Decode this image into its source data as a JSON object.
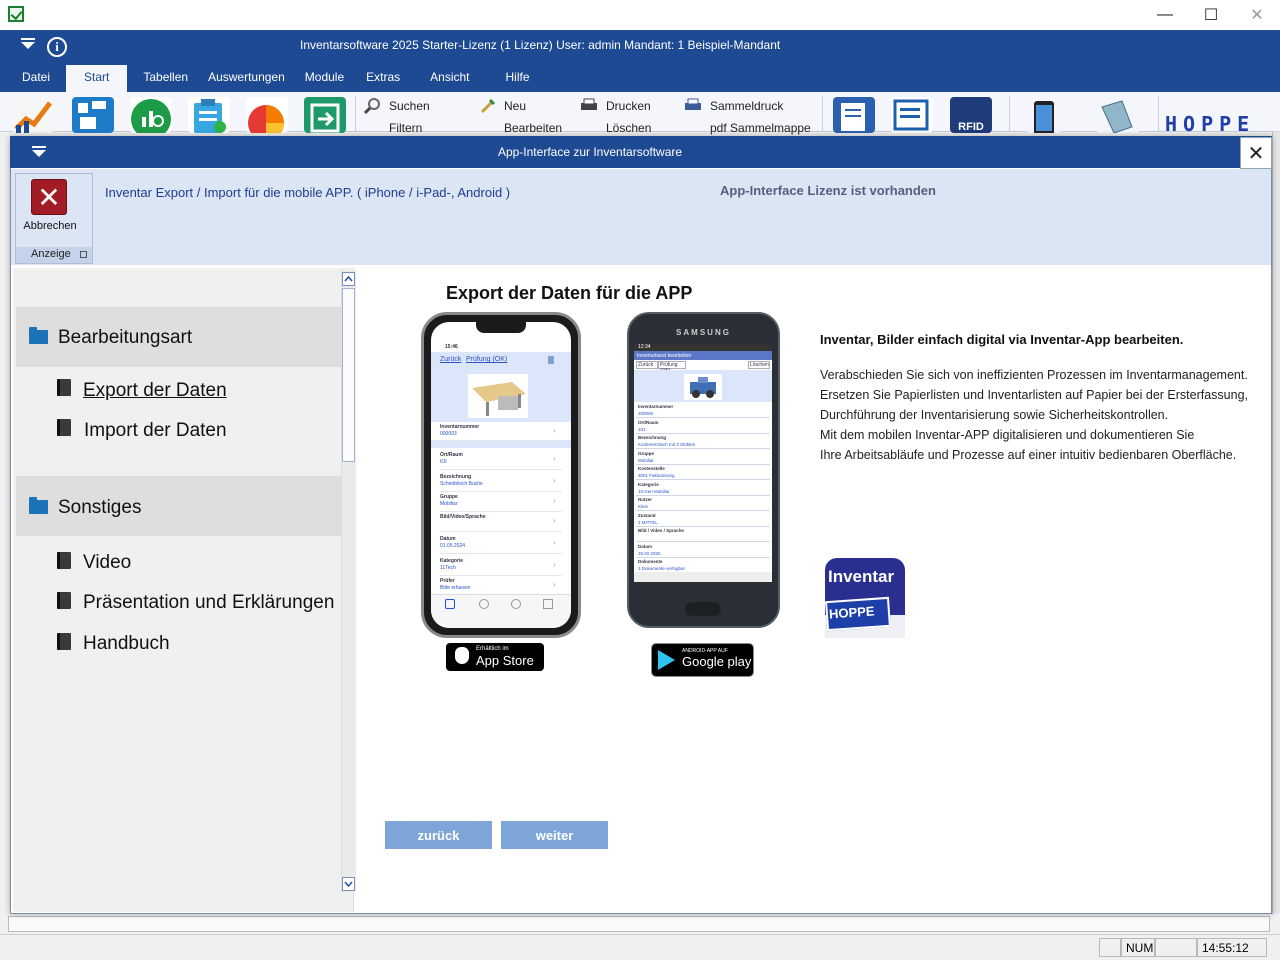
{
  "window": {
    "title": "Inventarsoftware 2025 Starter-Lizenz (1 Lizenz)   User: admin    Mandant: 1 Beispiel-Mandant",
    "minimize": "—",
    "maximize": "☐",
    "close": "✕"
  },
  "menu": [
    {
      "label": "Datei"
    },
    {
      "label": "Start",
      "active": true
    },
    {
      "label": "Tabellen"
    },
    {
      "label": "Auswertungen"
    },
    {
      "label": "Module"
    },
    {
      "label": "Extras"
    },
    {
      "label": "Ansicht"
    },
    {
      "label": "Hilfe"
    }
  ],
  "ribbon": {
    "suchen": "Suchen",
    "filtern": "Filtern",
    "neu": "Neu",
    "bearbeiten": "Bearbeiten",
    "drucken": "Drucken",
    "loeschen": "Löschen",
    "sammeldruck": "Sammeldruck",
    "pdf_sammelmappe": "pdf Sammelmappe",
    "rfid": "RFID",
    "brand": "HOPPE"
  },
  "dialog": {
    "title": "App-Interface zur Inventarsoftware",
    "close": "✕",
    "abort_label": "Abbrechen",
    "abort_glyph": "✕",
    "group_label": "Anzeige",
    "description": "Inventar Export / Import für die mobile APP. ( iPhone / i-Pad-, Android )",
    "license_note": "App-Interface Lizenz ist vorhanden"
  },
  "nav": {
    "sections": [
      {
        "label": "Bearbeitungsart",
        "items": [
          "Export der Daten",
          "Import  der Daten"
        ]
      },
      {
        "label": "Sonstiges",
        "items": [
          "Video",
          "Präsentation und Erklärungen",
          "Handbuch"
        ]
      }
    ]
  },
  "content": {
    "title": "Export der Daten für die APP",
    "iphone": {
      "time": "15:46",
      "back": "Zurück",
      "nav": "Prüfung (OK)",
      "fields": [
        {
          "label": "Inventarnummer",
          "value": "000003"
        },
        {
          "label": "Ort/Raum",
          "value": "IOI"
        },
        {
          "label": "Bezeichnung",
          "value": "Schreibtisch Buche"
        },
        {
          "label": "Gruppe",
          "value": "Mobiliar"
        },
        {
          "label": "Bild/Video/Sprache",
          "value": ""
        },
        {
          "label": "Datum",
          "value": "01.05.2024"
        },
        {
          "label": "Kategorie",
          "value": "11Tech"
        },
        {
          "label": "Prüfer",
          "value": "Bitte erfassen"
        }
      ]
    },
    "samsung": {
      "brand": "SAMSUNG",
      "time": "12:34",
      "header": "Inventurbarst bearbeiten",
      "back": "Zurück",
      "nav": "Prüfung (OK)",
      "delete": "Löschen",
      "fields": [
        {
          "label": "Inventarnummer",
          "value": "200006"
        },
        {
          "label": "Ort/Raum",
          "value": "101"
        },
        {
          "label": "Bezeichnung",
          "value": "Konferenztisch mit 3 Stühlen"
        },
        {
          "label": "Gruppe",
          "value": "Mobiliar"
        },
        {
          "label": "Kostenstelle",
          "value": "3001 Fakturierung"
        },
        {
          "label": "Kategorie",
          "value": "10.Gen Mobiliar"
        },
        {
          "label": "Nutzer",
          "value": "Klein"
        },
        {
          "label": "Zustand",
          "value": "3 MITTEL"
        },
        {
          "label": "Bild / Video / Sprache",
          "value": ""
        },
        {
          "label": "Datum",
          "value": "26.02.2025"
        },
        {
          "label": "Dokumente",
          "value": "1 Dokumente verfügbar"
        }
      ]
    },
    "appstore_small": "Erhältlich im",
    "appstore_big": "App Store",
    "gplay_small": "ANDROID-APP AUF",
    "gplay_big": "Google play",
    "info_heading": "Inventar, Bilder einfach digital via Inventar-App bearbeiten.",
    "info_lines": [
      "Verabschieden Sie sich von ineffizienten Prozessen im Inventarmanagement.",
      "Ersetzen Sie Papierlisten und Inventarlisten auf Papier bei der Ersterfassung,",
      "Durchführung der Inventarisierung sowie Sicherheitskontrollen.",
      "Mit dem mobilen Inventar-APP digitalisieren und dokumentieren Sie",
      "Ihre Arbeitsabläufe und Prozesse auf einer intuitiv bedienbaren Oberfläche."
    ],
    "logo_text": "Inventar",
    "logo_card": "HOPPE",
    "back_button": "zurück",
    "next_button": "weiter"
  },
  "status": {
    "num": "NUM",
    "time": "14:55:12"
  },
  "colors": {
    "title_bar": "#1e4a93",
    "ribbon_bg": "#dbe5f4",
    "button_bg": "#7ea5d8",
    "abort_red": "#a11c25"
  }
}
